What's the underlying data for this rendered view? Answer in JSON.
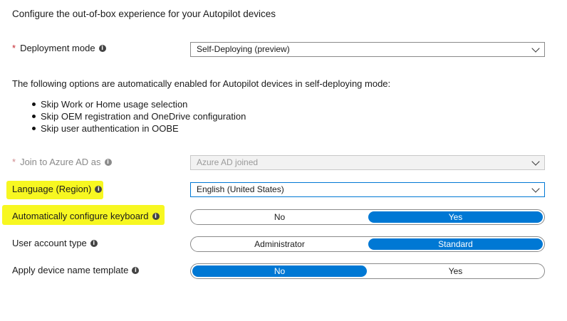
{
  "heading": "Configure the out-of-box experience for your Autopilot devices",
  "deployment_mode": {
    "required_mark": "*",
    "label": "Deployment mode",
    "value": "Self-Deploying (preview)"
  },
  "note": "The following options are automatically enabled for Autopilot devices in self-deploying mode:",
  "bullets": [
    "Skip Work or Home usage selection",
    "Skip OEM registration and OneDrive configuration",
    "Skip user authentication in OOBE"
  ],
  "join_azure": {
    "required_mark": "*",
    "label": "Join to Azure AD as",
    "value": "Azure AD joined"
  },
  "language": {
    "label": "Language (Region)",
    "value": "English (United States)"
  },
  "keyboard": {
    "label": "Automatically configure keyboard",
    "options": [
      "No",
      "Yes"
    ],
    "selected": "Yes"
  },
  "account_type": {
    "label": "User account type",
    "options": [
      "Administrator",
      "Standard"
    ],
    "selected": "Standard"
  },
  "device_name": {
    "label": "Apply device name template",
    "options": [
      "No",
      "Yes"
    ],
    "selected": "No"
  },
  "highlight_color": "#f7f721",
  "accent_color": "#0078d4",
  "icons": {
    "info": "info-icon",
    "chevron": "chevron-down-icon"
  }
}
